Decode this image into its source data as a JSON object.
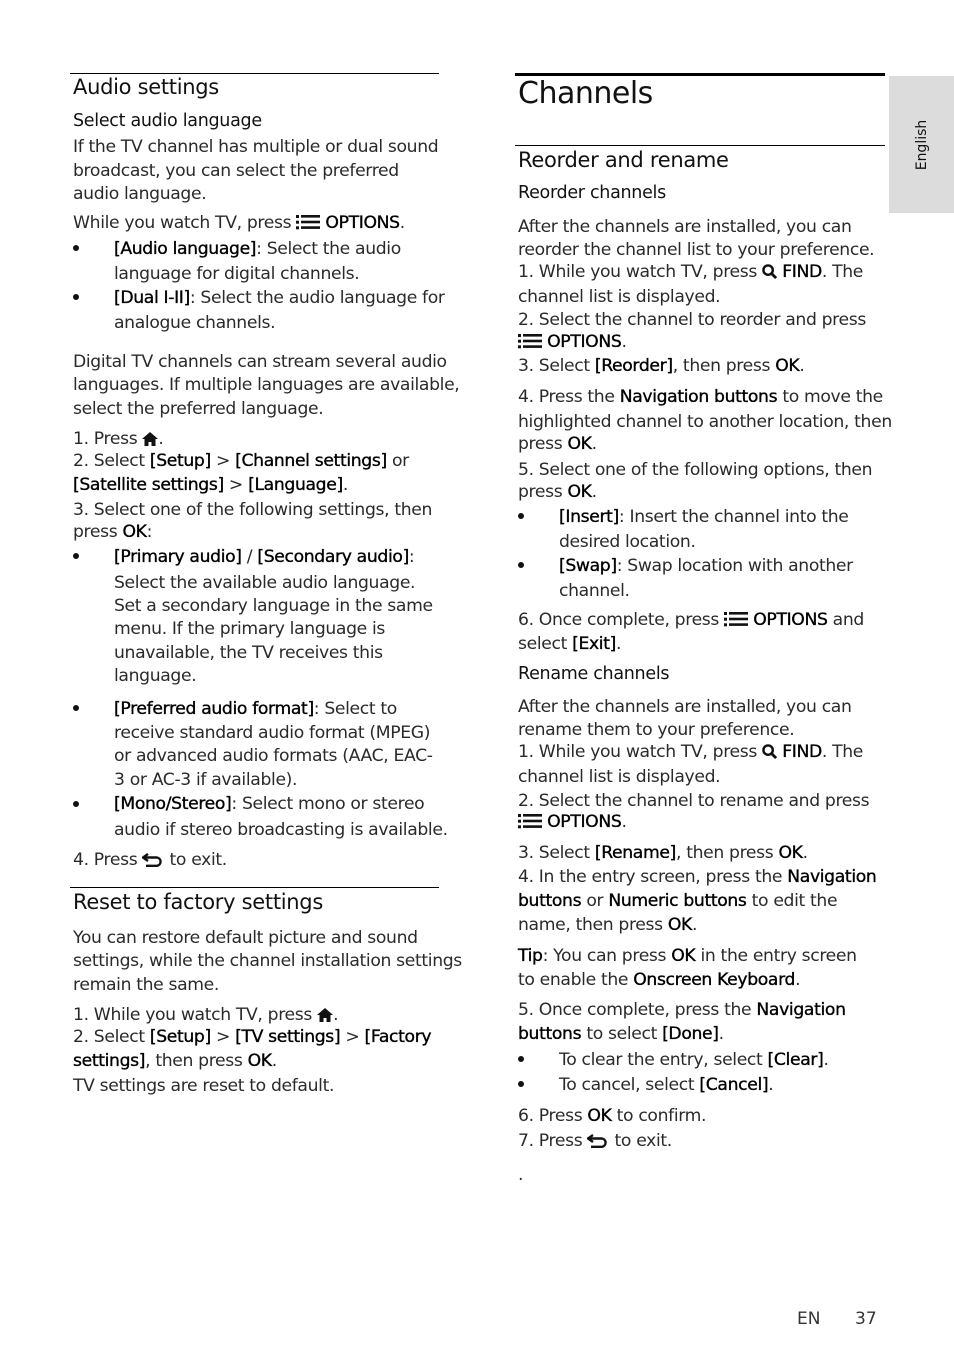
{
  "side_tab": {
    "label": "English"
  },
  "footer": {
    "lang": "EN",
    "page": "37"
  },
  "left": {
    "audio": {
      "title": "Audio settings",
      "sub": "Select audio language",
      "p1": [
        "If the TV channel has multiple or dual sound",
        "broadcast, you can select the preferred",
        "audio language."
      ],
      "press_pre": "While you watch TV, press ",
      "options": "OPTIONS",
      "b1_bold": "[Audio language]",
      "b1_rest": ": Select the audio",
      "b1_l2": "language for digital channels.",
      "b2_bold": "[Dual I-II]",
      "b2_rest": ": Select the audio language for",
      "b2_l2": "analogue channels.",
      "p2": [
        "Digital TV channels can stream several audio",
        "languages. If multiple languages are available,",
        "select the preferred language."
      ],
      "s1": "1. Press ",
      "s2_pre": "2. Select ",
      "setup": "[Setup]",
      "gt": " > ",
      "chan": "[Channel settings]",
      "or": " or",
      "sat": "[Satellite settings]",
      "lang": "[Language]",
      "s3": "3. Select one of the following settings, then",
      "press": "press ",
      "ok": "OK",
      "b3_bold1": "[Primary audio]",
      "b3_sep": " / ",
      "b3_bold2": "[Secondary audio]",
      "b3_lines": [
        "Select the available audio language.",
        "Set a secondary language in the same",
        "menu. If the primary language is",
        "unavailable, the TV receives this",
        "language."
      ],
      "b4_bold": "[Preferred audio format]",
      "b4_rest": ": Select to",
      "b4_lines": [
        "receive standard audio format (MPEG)",
        "or advanced audio formats (AAC, EAC-",
        "3 or AC-3 if available)."
      ],
      "b5_bold": "[Mono/Stereo]",
      "b5_rest": ": Select mono or stereo",
      "b5_l2": "audio if stereo broadcasting is available.",
      "s4_pre": "4. Press ",
      "s4_post": " to exit."
    },
    "reset": {
      "title": "Reset to factory settings",
      "p": [
        "You can restore default picture and sound",
        "settings, while the channel installation settings",
        "remain the same."
      ],
      "s1": "1. While you watch TV, press ",
      "s2_pre": "2. Select ",
      "setup": "[Setup]",
      "tv": "[TV settings]",
      "fact1": "[Factory",
      "fact2": "settings]",
      "then": ", then press ",
      "ok": "OK",
      "done": "TV settings are reset to default."
    }
  },
  "right": {
    "title": "Channels",
    "section": "Reorder and rename",
    "reorder": {
      "sub": "Reorder channels",
      "p": [
        "After the channels are installed, you can",
        "reorder the channel list to your preference."
      ],
      "s1_pre": "1. While you watch TV, press ",
      "find": "FIND",
      "s1_post": ". The",
      "s1_l2": "channel list is displayed.",
      "s2": "2. Select the channel to reorder and press",
      "options": "OPTIONS",
      "s3_pre": "3. Select ",
      "reorder": "[Reorder]",
      "then": ", then press ",
      "ok": "OK",
      "s4_pre": "4. Press the ",
      "nav": "Navigation buttons",
      "s4_post": " to move the",
      "s4_l2": "highlighted channel to another location, then",
      "press": "press ",
      "s5": "5. Select one of the following options, then",
      "b1_bold": "[Insert]",
      "b1_rest": ": Insert the channel into the",
      "b1_l2": "desired location.",
      "b2_bold": "[Swap]",
      "b2_rest": ": Swap location with another",
      "b2_l2": "channel.",
      "s6_pre": "6. Once complete, press ",
      "s6_post": " and",
      "select": "select ",
      "exit": "[Exit]"
    },
    "rename": {
      "sub": "Rename channels",
      "p": [
        "After the channels are installed, you can",
        "rename them to your preference."
      ],
      "s1_pre": "1. While you watch TV, press ",
      "s1_l2": "channel list is displayed.",
      "s2": "2. Select the channel to rename and press",
      "s3_pre": "3. Select ",
      "rename": "[Rename]",
      "s4_pre": "4. In the entry screen, press the ",
      "nav1": "Navigation",
      "nav2": "buttons",
      "or": " or ",
      "num": "Numeric buttons",
      "s4_post": " to edit the",
      "s4_l3": "name, then press ",
      "tip": "Tip",
      "tip_rest": ": You can press ",
      "tip_rest2": " in the entry screen",
      "tip_l2": "to enable the ",
      "kbd": "Onscreen Keyboard",
      "s5_pre": "5. Once complete, press the ",
      "s5_l2_post": " to select ",
      "done": "[Done]",
      "b1_pre": "To clear the entry, select ",
      "clear": "[Clear]",
      "b2_pre": "To cancel, select ",
      "cancel": "[Cancel]",
      "s6_pre": "6. Press ",
      "s6_post": " to confirm.",
      "s7_pre": "7. Press ",
      "s7_post": " to exit.",
      "dot": "."
    }
  }
}
